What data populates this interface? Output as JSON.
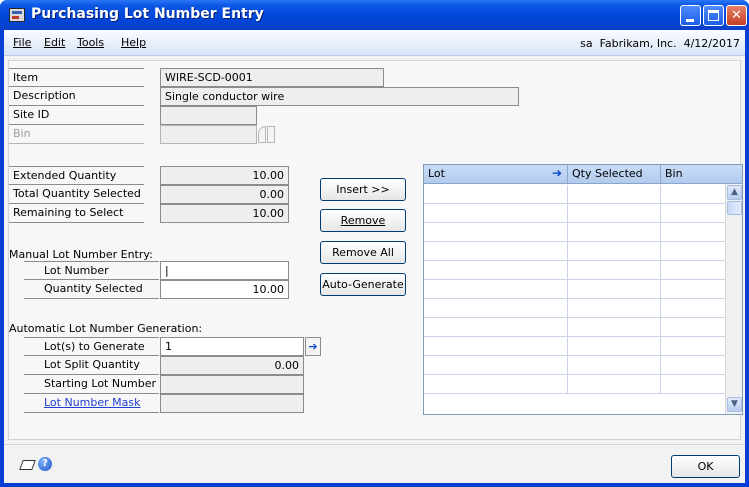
{
  "window": {
    "title": "Purchasing Lot Number Entry"
  },
  "menu": {
    "items": [
      {
        "label": "File"
      },
      {
        "label": "Edit"
      },
      {
        "label": "Tools"
      },
      {
        "label": "Help"
      }
    ],
    "status": "sa  Fabrikam, Inc.  4/12/2017"
  },
  "header": {
    "item_label": "Item",
    "item_value": "WIRE-SCD-0001",
    "description_label": "Description",
    "description_value": "Single conductor wire",
    "site_label": "Site ID",
    "site_value": "",
    "bin_label": "Bin",
    "bin_value": ""
  },
  "quantities": {
    "extended_label": "Extended Quantity",
    "extended_value": "10.00",
    "total_selected_label": "Total Quantity Selected",
    "total_selected_value": "0.00",
    "remaining_label": "Remaining to Select",
    "remaining_value": "10.00"
  },
  "manual": {
    "heading": "Manual Lot Number Entry:",
    "lot_number_label": "Lot Number",
    "lot_number_value": "|",
    "qty_selected_label": "Quantity Selected",
    "qty_selected_value": "10.00"
  },
  "automatic": {
    "heading": "Automatic Lot Number Generation:",
    "lots_to_generate_label": "Lot(s) to Generate",
    "lots_to_generate_value": "1",
    "split_qty_label": "Lot Split Quantity",
    "split_qty_value": "0.00",
    "starting_lot_label": "Starting Lot Number",
    "starting_lot_value": "",
    "mask_label": "Lot Number Mask",
    "mask_value": ""
  },
  "buttons": {
    "insert": "Insert >>",
    "remove": "Remove",
    "remove_all": "Remove All",
    "auto_generate": "Auto-Generate",
    "ok": "OK"
  },
  "grid": {
    "columns": [
      "Lot",
      "Qty Selected",
      "Bin"
    ],
    "rows": 11
  },
  "icons": {
    "note": "note-icon",
    "help": "help-icon",
    "expand": "arrow-right-icon"
  }
}
